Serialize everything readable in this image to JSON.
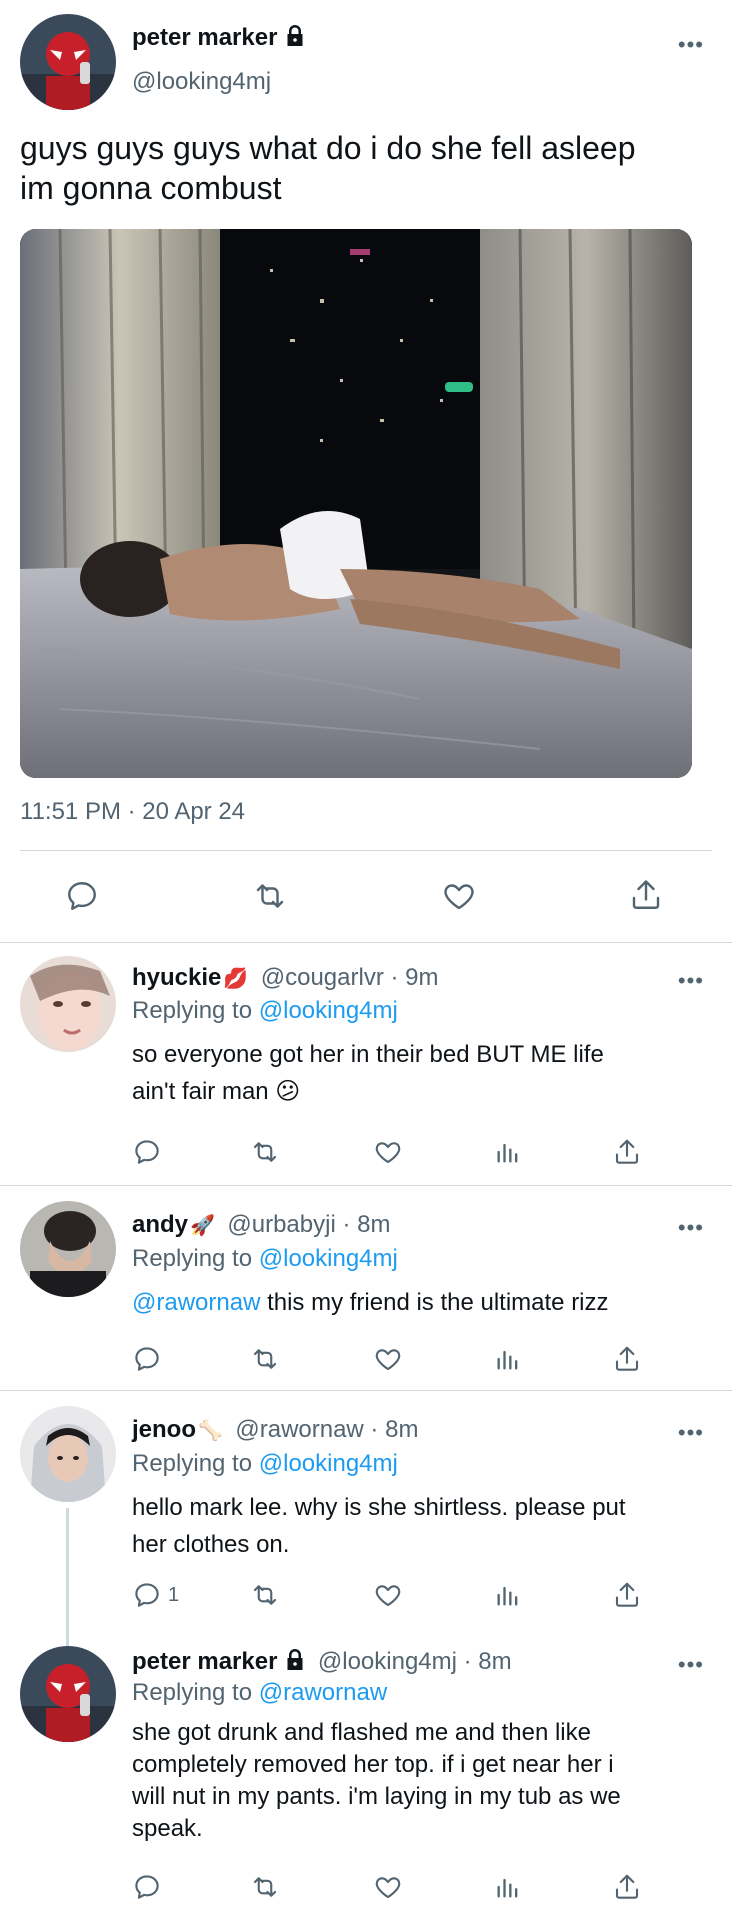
{
  "main_tweet": {
    "name": "peter marker",
    "handle": "@looking4mj",
    "text_line1": "guys guys guys what do i do she fell asleep",
    "text_line2": "im gonna combust",
    "timestamp": "11:51 PM · 20 Apr 24"
  },
  "replies": [
    {
      "name": "hyuckie",
      "emoji": "💋",
      "handle_time": "@cougarlvr · 9m",
      "replying_prefix": "Replying to",
      "replying_to": "@looking4mj",
      "text_line1": "so everyone got her in their bed BUT ME life",
      "text_line2": "ain't fair man 😕"
    },
    {
      "name": "andy",
      "emoji": "🚀",
      "handle_time": "@urbabyji · 8m",
      "replying_prefix": "Replying to",
      "replying_to": "@looking4mj",
      "mention": "@rawornaw",
      "text": " this my friend is the ultimate rizz"
    },
    {
      "name": "jenoo",
      "emoji": "🦴",
      "handle_time": "@rawornaw · 8m",
      "replying_prefix": "Replying to",
      "replying_to": "@looking4mj",
      "text_line1": "hello mark lee. why is she shirtless. please put",
      "text_line2": "her clothes on.",
      "reply_count": "1"
    },
    {
      "name": "peter marker",
      "handle_time": "@looking4mj · 8m",
      "replying_prefix": "Replying to",
      "replying_to": "@rawornaw",
      "text_line1": "she got drunk and flashed me and then like",
      "text_line2": "completely removed her top. if i get near her i",
      "text_line3": "will nut in my pants. i'm laying in my tub as we",
      "text_line4": "speak."
    }
  ],
  "colors": {
    "link": "#1d9bf0",
    "secondary_text": "#536471",
    "divider": "#cfd9de"
  },
  "icons": [
    "more-icon",
    "lock-icon",
    "reply-icon",
    "retweet-icon",
    "like-icon",
    "analytics-icon",
    "share-icon"
  ]
}
